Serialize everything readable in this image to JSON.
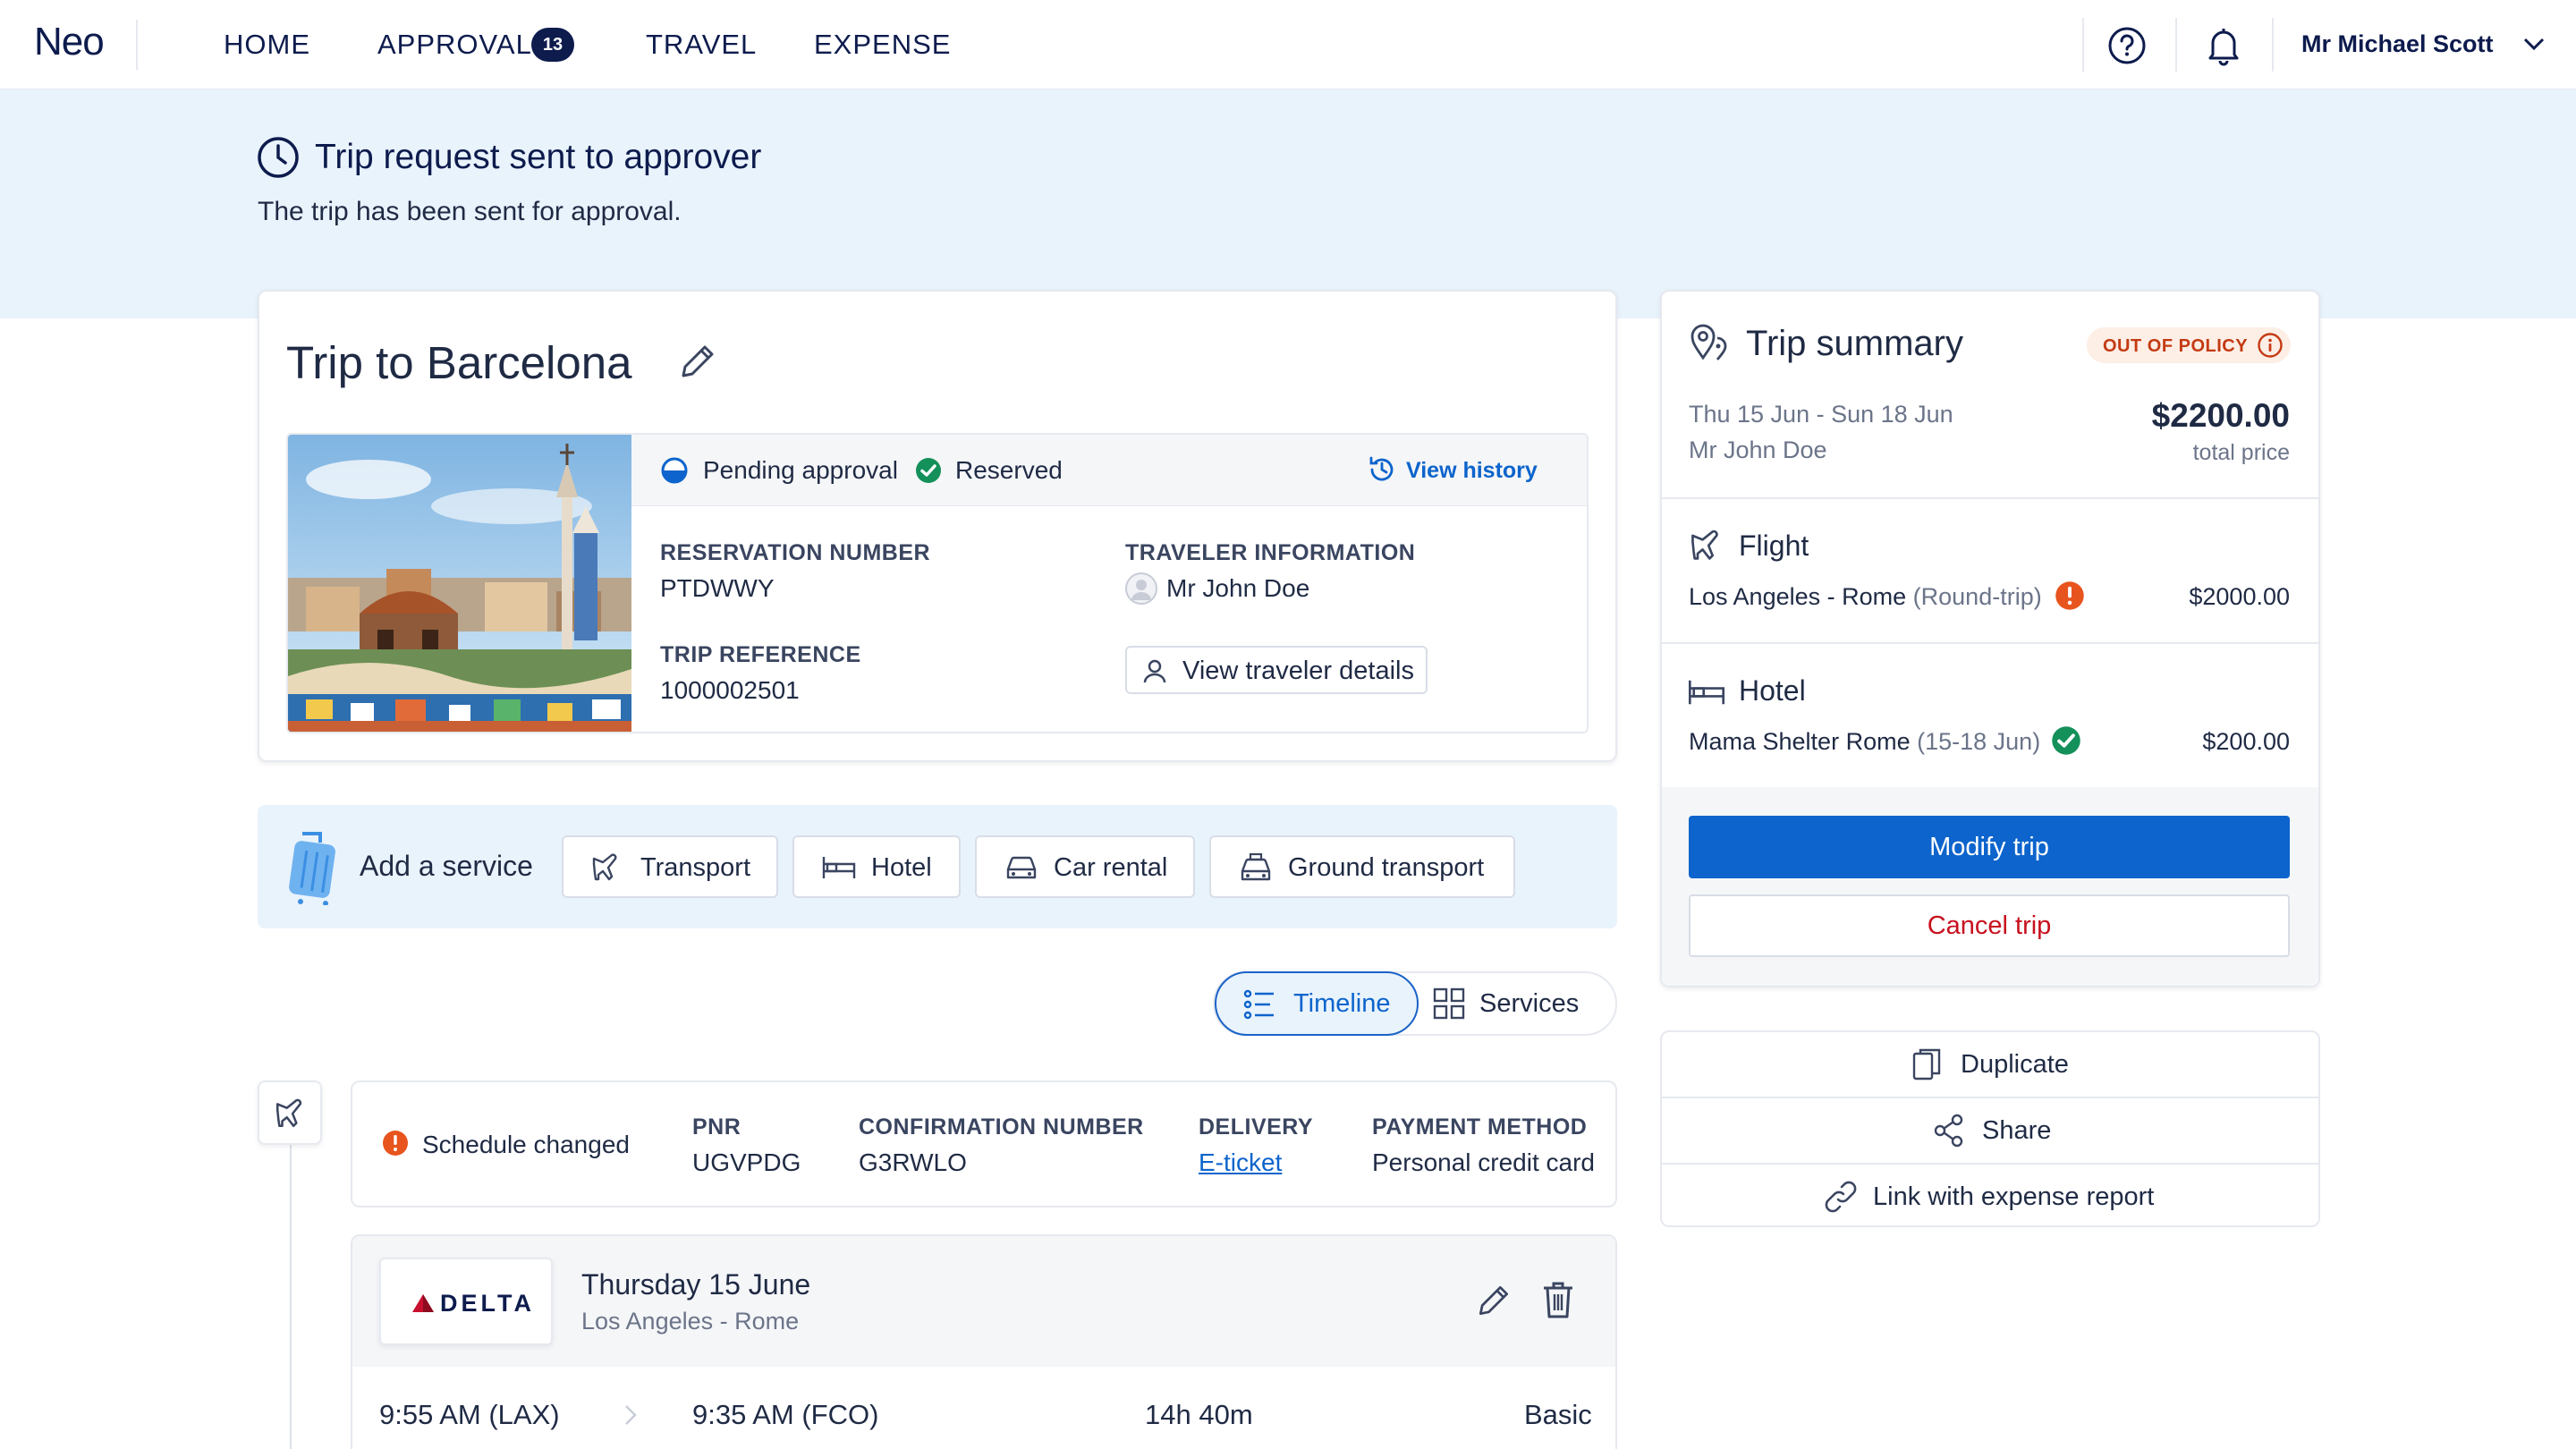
{
  "nav": {
    "brand": "Neo",
    "links": [
      "HOME",
      "APPROVAL",
      "TRAVEL",
      "EXPENSE"
    ],
    "approval_count": "13",
    "user_name": "Mr Michael Scott"
  },
  "banner": {
    "title": "Trip request sent to approver",
    "subtitle": "The trip has been sent for approval."
  },
  "trip": {
    "title": "Trip to Barcelona",
    "status_pending": "Pending approval",
    "status_reserved": "Reserved",
    "view_history": "View history",
    "reservation_label": "RESERVATION NUMBER",
    "reservation_value": "PTDWWY",
    "traveler_label": "TRAVELER INFORMATION",
    "traveler_name": "Mr John Doe",
    "trip_ref_label": "TRIP REFERENCE",
    "trip_ref_value": "1000002501",
    "view_traveler_details": "View traveler details"
  },
  "add_service": {
    "label": "Add a service",
    "options": [
      "Transport",
      "Hotel",
      "Car rental",
      "Ground transport"
    ]
  },
  "view_toggle": {
    "timeline": "Timeline",
    "services": "Services"
  },
  "flight_info": {
    "status": "Schedule changed",
    "pnr_label": "PNR",
    "pnr_value": "UGVPDG",
    "confirmation_label": "CONFIRMATION NUMBER",
    "confirmation_value": "G3RWLO",
    "delivery_label": "DELIVERY",
    "delivery_value": "E-ticket",
    "payment_label": "PAYMENT METHOD",
    "payment_value": "Personal credit card"
  },
  "flight_segment": {
    "airline": "DELTA",
    "date": "Thursday 15 June",
    "route": "Los Angeles - Rome",
    "depart": "9:55 AM (LAX)",
    "arrive": "9:35 AM (FCO)",
    "duration": "14h 40m",
    "fare": "Basic"
  },
  "summary": {
    "title": "Trip summary",
    "policy_badge": "OUT OF POLICY",
    "dates": "Thu 15 Jun - Sun 18 Jun",
    "traveler": "Mr John Doe",
    "total": "$2200.00",
    "total_label": "total price",
    "flight_heading": "Flight",
    "flight_route": "Los Angeles - Rome",
    "flight_type": "(Round-trip)",
    "flight_price": "$2000.00",
    "hotel_heading": "Hotel",
    "hotel_name": "Mama Shelter Rome",
    "hotel_dates": "(15-18 Jun)",
    "hotel_price": "$200.00",
    "modify": "Modify trip",
    "cancel": "Cancel trip"
  },
  "actions": {
    "duplicate": "Duplicate",
    "share": "Share",
    "link_expense": "Link with expense report"
  },
  "colors": {
    "navy": "#0d1b4d",
    "primary": "#0c64cc",
    "banner_bg": "#e9f3fc",
    "success": "#14905a",
    "warning": "#e8541e",
    "danger": "#c8101e",
    "delta_red": "#c8102e"
  }
}
